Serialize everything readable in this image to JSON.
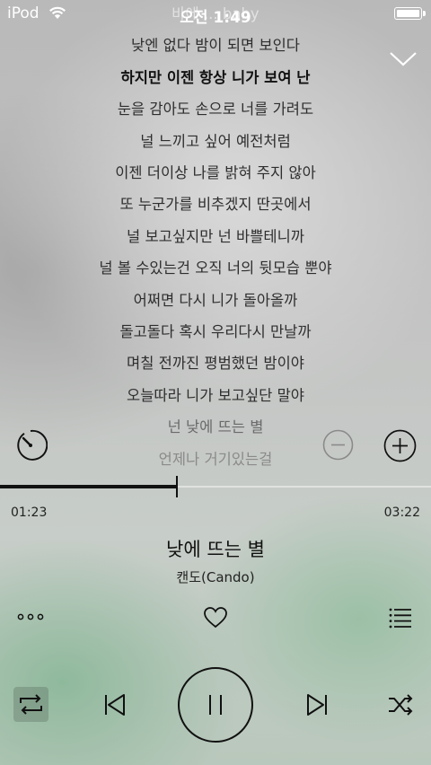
{
  "status_bar": {
    "carrier": "iPod",
    "time": "오전 1:49"
  },
  "lyrics": [
    "바에 ... baby",
    "낮엔 없다 밤이 되면 보인다",
    "하지만 이젠 항상 니가 보여 난",
    "눈을 감아도 손으로 너를 가려도",
    "널 느끼고 싶어 예전처럼",
    "이젠 더이상 나를 밝혀 주지 않아",
    "또 누군가를 비추겠지 딴곳에서",
    "널 보고싶지만 넌 바쁠테니까",
    "널 볼 수있는건 오직 너의 뒷모습 뿐야",
    "어쩌면 다시 니가 돌아올까",
    "돌고돌다 혹시 우리다시 만날까",
    "며칠 전까진 평범했던 밤이야",
    "오늘따라 니가 보고싶단 말야",
    "넌 낮에 뜨는 별",
    "언제나 거기있는걸"
  ],
  "current_lyric_index": 2,
  "playback": {
    "elapsed": "01:23",
    "total": "03:22",
    "progress": 0.41
  },
  "song": {
    "title": "낮에 뜨는 별",
    "artist": "캔도(Cando)"
  },
  "icons": {
    "collapse": "chevron-down-icon",
    "timer": "timer-icon",
    "font_smaller": "minus-circle-icon",
    "font_larger": "plus-circle-icon",
    "more": "more-dots-icon",
    "like": "heart-icon",
    "playlist": "playlist-icon",
    "repeat": "repeat-icon",
    "previous": "previous-track-icon",
    "pause": "pause-icon",
    "next": "next-track-icon",
    "shuffle": "shuffle-icon"
  },
  "colors": {
    "foreground": "#111111",
    "repeat_active_bg": "#5a6e5f"
  }
}
